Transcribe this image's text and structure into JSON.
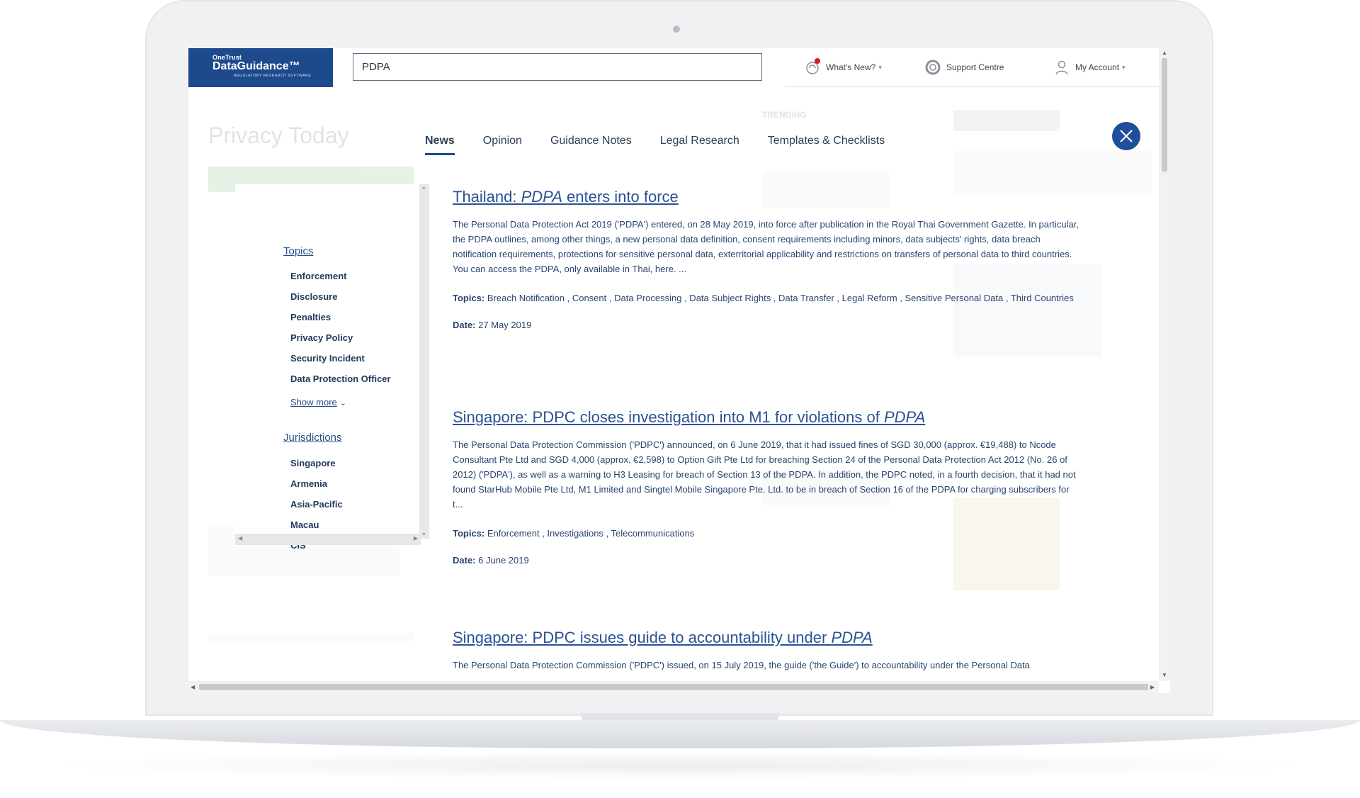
{
  "app": {
    "logo_small": "OneTrust",
    "logo_main": "DataGuidance™",
    "logo_sub": "REGULATORY RESEARCH SOFTWARE"
  },
  "search": {
    "value": "PDPA"
  },
  "top_links": {
    "whats_new": "What's New?",
    "support": "Support Centre",
    "account": "My Account"
  },
  "tabs": [
    "News",
    "Opinion",
    "Guidance Notes",
    "Legal Research",
    "Templates & Checklists"
  ],
  "filters": {
    "topics_heading": "Topics",
    "topics": [
      "Enforcement",
      "Disclosure",
      "Penalties",
      "Privacy Policy",
      "Security Incident",
      "Data Protection Officer"
    ],
    "show_more": "Show more",
    "jurisdictions_heading": "Jurisdictions",
    "jurisdictions": [
      "Singapore",
      "Armenia",
      "Asia-Pacific",
      "Macau",
      "CIS"
    ]
  },
  "labels": {
    "topics": "Topics:",
    "date": "Date:"
  },
  "results": [
    {
      "title_prefix": "Thailand: ",
      "title_hl": "PDPA",
      "title_suffix": " enters into force",
      "body": "The Personal Data Protection Act 2019 ('PDPA') entered, on 28 May 2019, into force after publication in the Royal Thai Government Gazette. In particular, the PDPA outlines, among other things, a new personal data definition, consent requirements including minors, data subjects' rights, data breach notification requirements, protections for sensitive personal data, exterritorial applicability and restrictions on transfers of personal data to third countries. You can access the PDPA, only available in Thai, here. ...",
      "topics": "Breach Notification , Consent , Data Processing , Data Subject Rights , Data Transfer , Legal Reform , Sensitive Personal Data , Third Countries",
      "date": "27 May 2019"
    },
    {
      "title_prefix": "Singapore: PDPC closes investigation into M1 for violations of ",
      "title_hl": "PDPA",
      "title_suffix": "",
      "body": "The Personal Data Protection Commission ('PDPC') announced, on 6 June 2019, that it had issued fines of SGD 30,000 (approx. €19,488) to Ncode Consultant Pte Ltd and SGD 4,000 (approx. €2,598) to Option Gift Pte Ltd for breaching Section 24 of the Personal Data Protection Act 2012 (No. 26 of 2012) ('PDPA'), as well as a warning to H3 Leasing for breach of Section 13 of the PDPA. In addition, the PDPC noted, in a fourth decision, that it had not found StarHub Mobile Pte Ltd, M1 Limited and Singtel Mobile Singapore Pte. Ltd. to be in breach of Section 16 of the PDPA for charging subscribers for t...",
      "topics": "Enforcement , Investigations , Telecommunications",
      "date": "6 June 2019"
    },
    {
      "title_prefix": "Singapore: PDPC issues guide to accountability under ",
      "title_hl": "PDPA",
      "title_suffix": " ",
      "body": "The Personal Data Protection Commission ('PDPC') issued, on 15 July 2019, the guide ('the Guide') to accountability under the Personal Data"
    }
  ],
  "background": {
    "title": "Privacy Today",
    "trending": "TRENDING"
  },
  "colors": {
    "brand": "#1d4a8c",
    "link": "#2a5294",
    "close": "#1f4f9a"
  }
}
